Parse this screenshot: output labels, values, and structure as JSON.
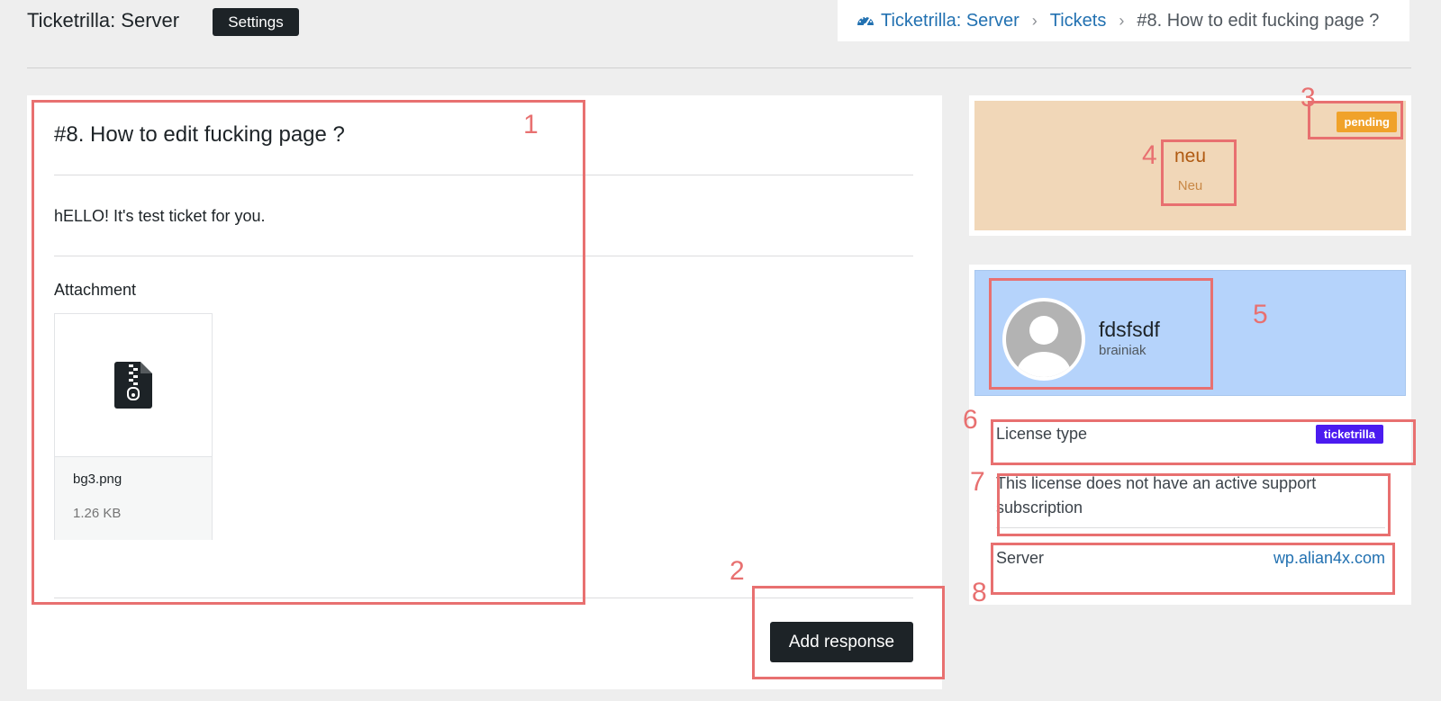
{
  "header": {
    "app_title": "Ticketrilla: Server",
    "settings_label": "Settings"
  },
  "breadcrumb": {
    "icon": "dashboard-gauge-icon",
    "items": [
      {
        "label": "Ticketrilla: Server"
      },
      {
        "label": "Tickets"
      },
      {
        "label": "#8. How to edit fucking page ?"
      }
    ],
    "separator": "›"
  },
  "ticket": {
    "title": "#8. How to edit fucking page ?",
    "body": "hELLO! It's test ticket for you.",
    "attachment_heading": "Attachment",
    "attachment": {
      "icon": "zip-file-icon",
      "name": "bg3.png",
      "size": "1.26 KB"
    },
    "add_response_label": "Add response"
  },
  "status": {
    "badge": "pending",
    "name": "neu",
    "sub": "Neu",
    "colors": {
      "panel": "#f1d7b8",
      "badge": "#f0a22a"
    }
  },
  "user": {
    "avatar_icon": "user-avatar-icon",
    "name": "fdsfsdf",
    "login": "brainiak",
    "license_label": "License type",
    "license_badge": "ticketrilla",
    "support_note": "This license does not have an active support subscription",
    "server_label": "Server",
    "server_value": "wp.alian4x.com"
  },
  "annotations": [
    "1",
    "2",
    "3",
    "4",
    "5",
    "6",
    "7",
    "8"
  ]
}
